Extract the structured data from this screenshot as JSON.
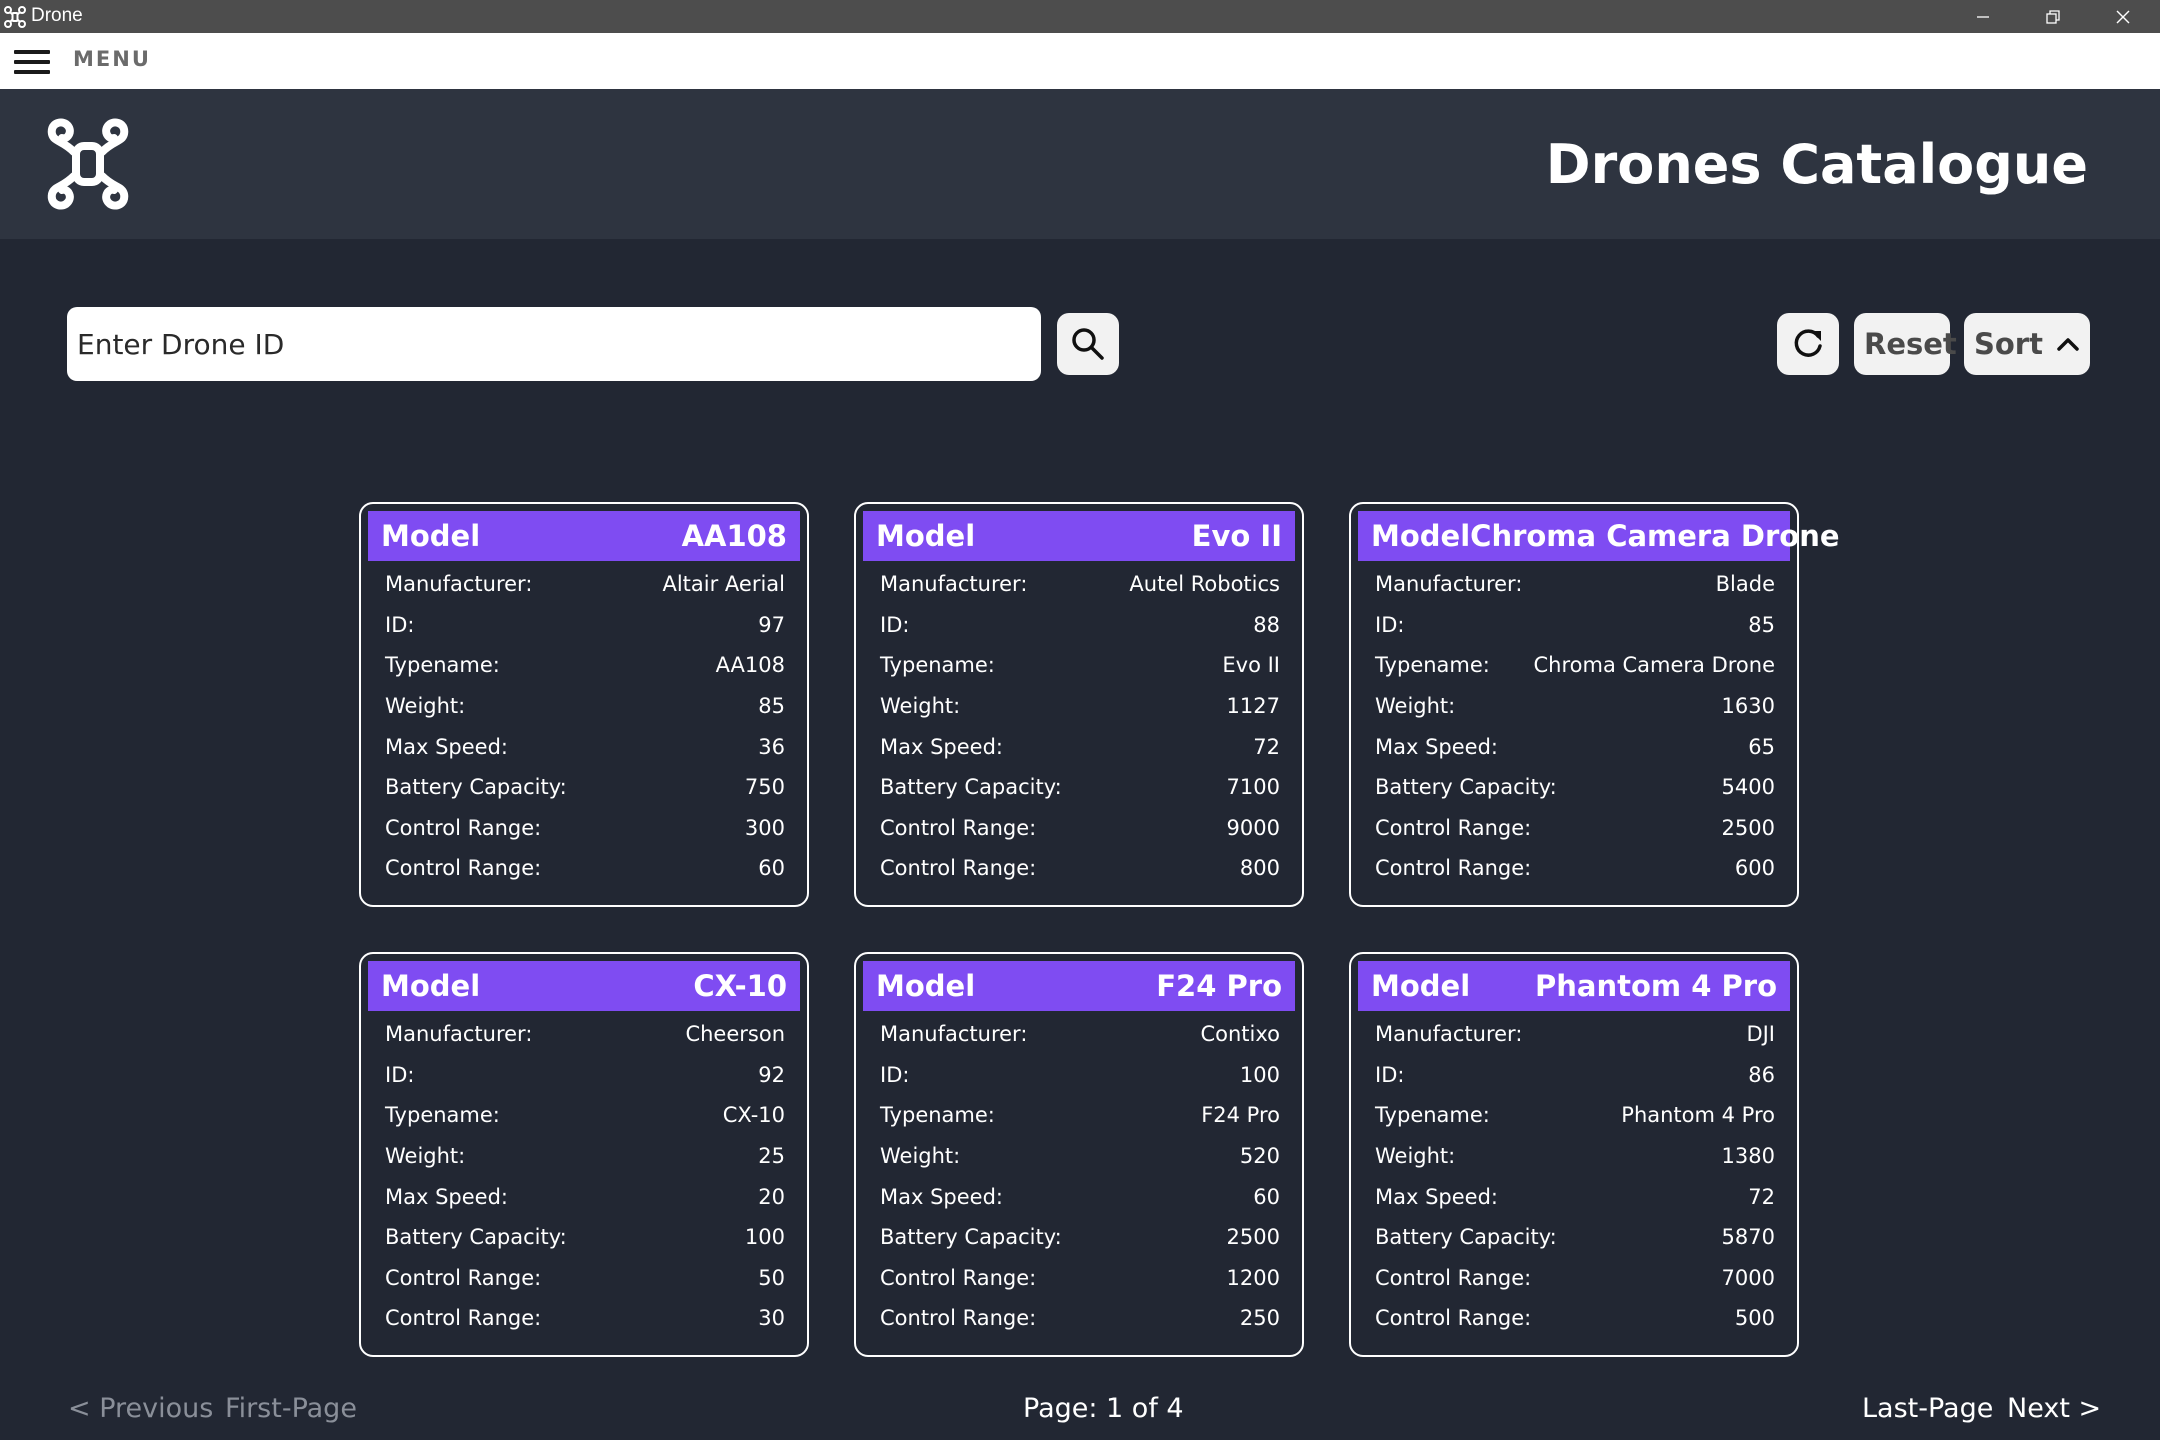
{
  "window": {
    "title": "Drone",
    "icons": [
      "drone-icon",
      "minimize-icon",
      "restore-icon",
      "close-icon"
    ]
  },
  "menubar": {
    "label": "MENU",
    "icon": "hamburger-icon"
  },
  "header": {
    "title": "Drones Catalogue",
    "logo_icon": "drone-logo-icon"
  },
  "search": {
    "placeholder": "Enter Drone ID",
    "search_icon": "search-icon"
  },
  "toolbar": {
    "refresh_icon": "refresh-icon",
    "reset_label": "Reset",
    "sort_label": "Sort",
    "sort_icon": "chevron-up-icon"
  },
  "colors": {
    "background": "#222733",
    "header_bg": "#2e3440",
    "card_header": "#7f4cf2",
    "titlebar": "#4d4d4d"
  },
  "cards": [
    {
      "model_label": "Model",
      "model_name": "AA108",
      "rows": [
        {
          "label": "Manufacturer:",
          "value": "Altair Aerial"
        },
        {
          "label": "ID:",
          "value": "97"
        },
        {
          "label": "Typename:",
          "value": "AA108"
        },
        {
          "label": "Weight:",
          "value": "85"
        },
        {
          "label": "Max Speed:",
          "value": "36"
        },
        {
          "label": "Battery Capacity:",
          "value": "750"
        },
        {
          "label": "Control Range:",
          "value": "300"
        },
        {
          "label": "Control Range:",
          "value": "60"
        }
      ]
    },
    {
      "model_label": "Model",
      "model_name": "Evo II",
      "rows": [
        {
          "label": "Manufacturer:",
          "value": "Autel Robotics"
        },
        {
          "label": "ID:",
          "value": "88"
        },
        {
          "label": "Typename:",
          "value": "Evo II"
        },
        {
          "label": "Weight:",
          "value": "1127"
        },
        {
          "label": "Max Speed:",
          "value": "72"
        },
        {
          "label": "Battery Capacity:",
          "value": "7100"
        },
        {
          "label": "Control Range:",
          "value": "9000"
        },
        {
          "label": "Control Range:",
          "value": "800"
        }
      ]
    },
    {
      "model_label": "Model",
      "model_name": "Chroma Camera Drone",
      "rows": [
        {
          "label": "Manufacturer:",
          "value": "Blade"
        },
        {
          "label": "ID:",
          "value": "85"
        },
        {
          "label": "Typename:",
          "value": "Chroma Camera Drone"
        },
        {
          "label": "Weight:",
          "value": "1630"
        },
        {
          "label": "Max Speed:",
          "value": "65"
        },
        {
          "label": "Battery Capacity:",
          "value": "5400"
        },
        {
          "label": "Control Range:",
          "value": "2500"
        },
        {
          "label": "Control Range:",
          "value": "600"
        }
      ]
    },
    {
      "model_label": "Model",
      "model_name": "CX-10",
      "rows": [
        {
          "label": "Manufacturer:",
          "value": "Cheerson"
        },
        {
          "label": "ID:",
          "value": "92"
        },
        {
          "label": "Typename:",
          "value": "CX-10"
        },
        {
          "label": "Weight:",
          "value": "25"
        },
        {
          "label": "Max Speed:",
          "value": "20"
        },
        {
          "label": "Battery Capacity:",
          "value": "100"
        },
        {
          "label": "Control Range:",
          "value": "50"
        },
        {
          "label": "Control Range:",
          "value": "30"
        }
      ]
    },
    {
      "model_label": "Model",
      "model_name": "F24 Pro",
      "rows": [
        {
          "label": "Manufacturer:",
          "value": "Contixo"
        },
        {
          "label": "ID:",
          "value": "100"
        },
        {
          "label": "Typename:",
          "value": "F24 Pro"
        },
        {
          "label": "Weight:",
          "value": "520"
        },
        {
          "label": "Max Speed:",
          "value": "60"
        },
        {
          "label": "Battery Capacity:",
          "value": "2500"
        },
        {
          "label": "Control Range:",
          "value": "1200"
        },
        {
          "label": "Control Range:",
          "value": "250"
        }
      ]
    },
    {
      "model_label": "Model",
      "model_name": "Phantom 4 Pro",
      "rows": [
        {
          "label": "Manufacturer:",
          "value": "DJI"
        },
        {
          "label": "ID:",
          "value": "86"
        },
        {
          "label": "Typename:",
          "value": "Phantom 4 Pro"
        },
        {
          "label": "Weight:",
          "value": "1380"
        },
        {
          "label": "Max Speed:",
          "value": "72"
        },
        {
          "label": "Battery Capacity:",
          "value": "5870"
        },
        {
          "label": "Control Range:",
          "value": "7000"
        },
        {
          "label": "Control Range:",
          "value": "500"
        }
      ]
    }
  ],
  "pagination": {
    "previous": "< Previous",
    "first": "First-Page",
    "status": "Page: 1 of 4",
    "last": "Last-Page",
    "next": "Next >"
  }
}
